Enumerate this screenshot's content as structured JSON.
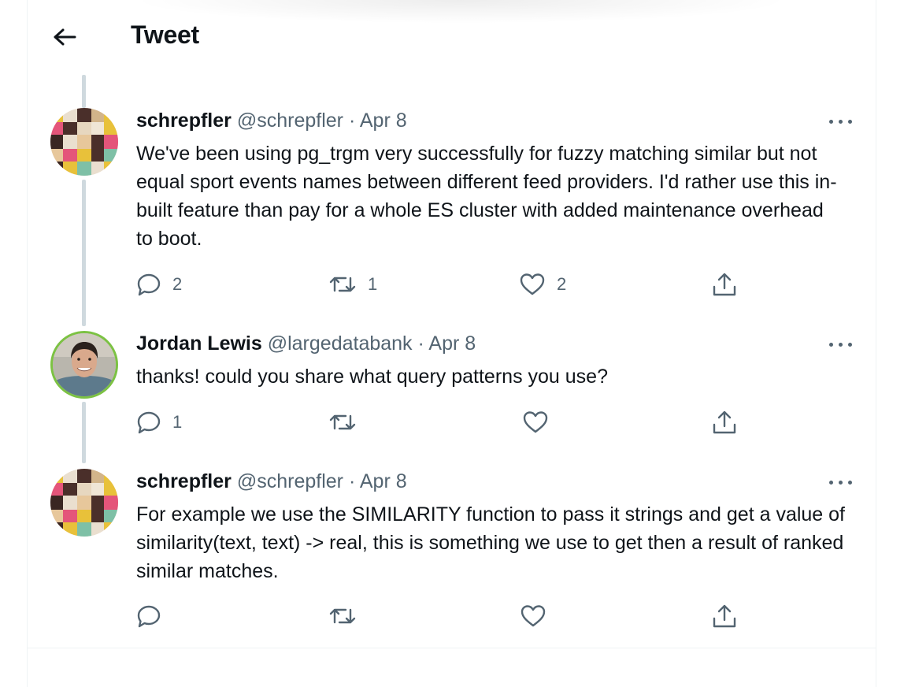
{
  "header": {
    "title": "Tweet",
    "back_icon": "arrow-left-icon"
  },
  "tweets": [
    {
      "name": "schrepfler",
      "handle": "@schrepfler",
      "dot": "·",
      "date": "Apr 8",
      "text": "We've been using pg_trgm very successfully for fuzzy matching similar but not equal sport events names between different feed providers. I'd rather use this in-built feature than pay for a whole ES cluster with added maintenance overhead to boot.",
      "replies": "2",
      "retweets": "1",
      "likes": "2",
      "avatar": "pixel-avatar"
    },
    {
      "name": "Jordan Lewis",
      "handle": "@largedatabank",
      "dot": "·",
      "date": "Apr 8",
      "text": "thanks! could you share what query patterns you use?",
      "replies": "1",
      "retweets": "",
      "likes": "",
      "avatar": "photo-avatar"
    },
    {
      "name": "schrepfler",
      "handle": "@schrepfler",
      "dot": "·",
      "date": "Apr 8",
      "text": "For example we use the SIMILARITY function to pass it strings and get a value of similarity(text, text) -> real, this is something we use to get then a result of ranked similar matches.",
      "replies": "",
      "retweets": "",
      "likes": "",
      "avatar": "pixel-avatar"
    }
  ],
  "colors": {
    "text": "#0f1419",
    "secondary": "#536471",
    "thread_line": "#cfd9de",
    "photo_ring": "#7cc243"
  },
  "icons": [
    "reply-icon",
    "retweet-icon",
    "like-icon",
    "share-icon",
    "more-icon"
  ]
}
